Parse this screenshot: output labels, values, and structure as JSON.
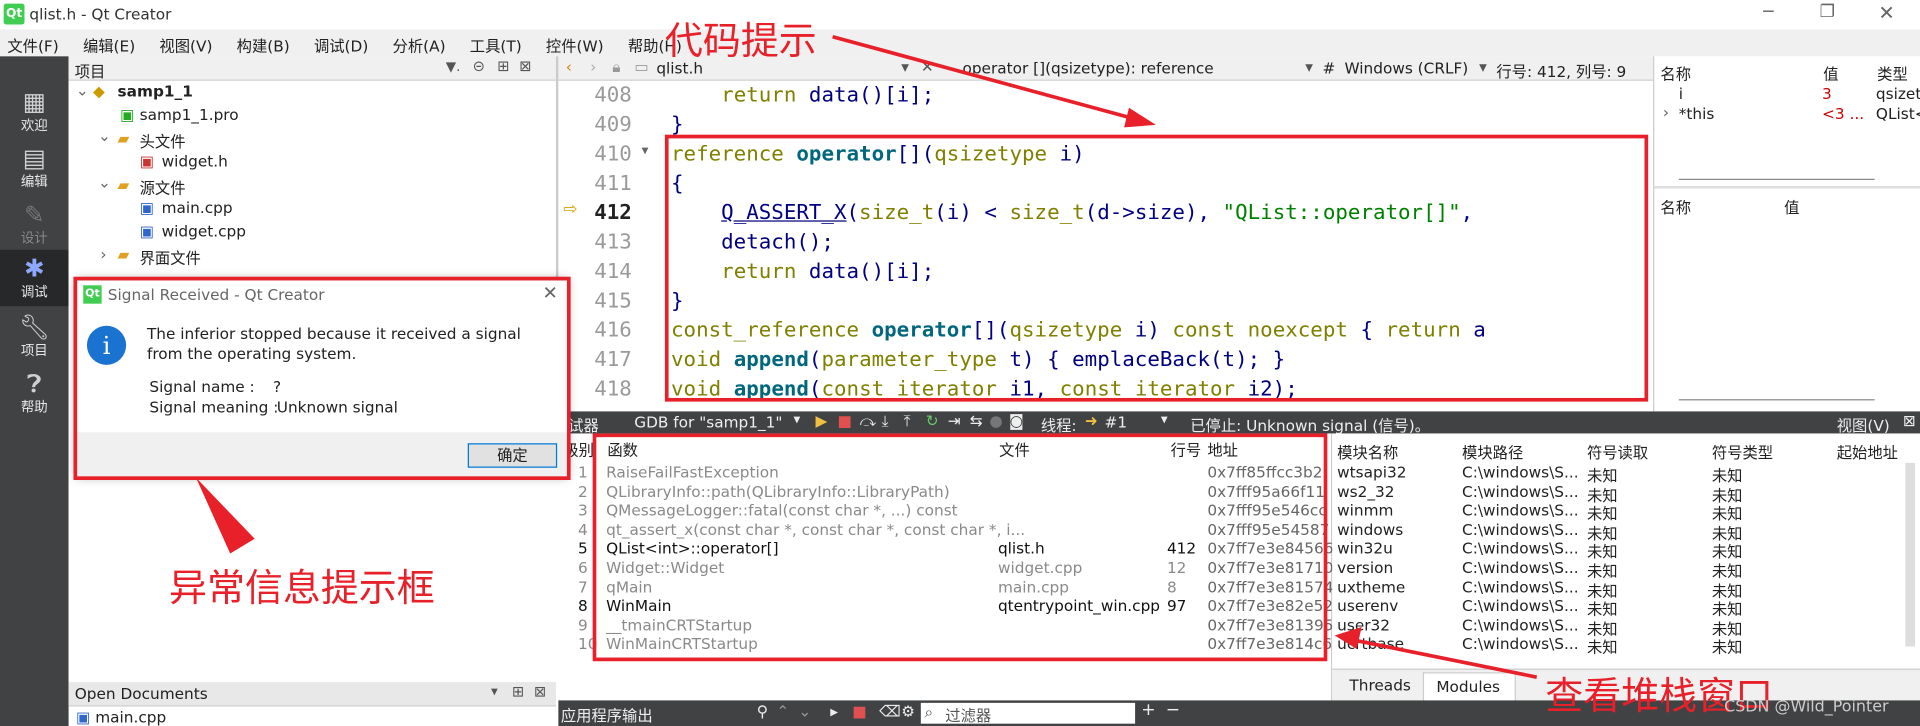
{
  "window": {
    "title": "qlist.h - Qt Creator"
  },
  "menu": [
    "文件(F)",
    "编辑(E)",
    "视图(V)",
    "构建(B)",
    "调试(D)",
    "分析(A)",
    "工具(T)",
    "控件(W)",
    "帮助(H)"
  ],
  "modes": [
    {
      "label": "欢迎",
      "icon": "grid-icon"
    },
    {
      "label": "编辑",
      "icon": "edit-icon"
    },
    {
      "label": "设计",
      "icon": "pencil-icon"
    },
    {
      "label": "调试",
      "icon": "bug-icon"
    },
    {
      "label": "项目",
      "icon": "wrench-icon"
    },
    {
      "label": "帮助",
      "icon": "help-icon"
    }
  ],
  "project": {
    "header": "项目",
    "tree": [
      {
        "label": "samp1_1",
        "bold": true,
        "icon": "project-icon"
      },
      {
        "label": "samp1_1.pro",
        "icon": "pro-file-icon"
      },
      {
        "label": "头文件",
        "icon": "folder-icon"
      },
      {
        "label": "widget.h",
        "icon": "h-file-icon"
      },
      {
        "label": "源文件",
        "icon": "folder-icon"
      },
      {
        "label": "main.cpp",
        "icon": "cpp-file-icon"
      },
      {
        "label": "widget.cpp",
        "icon": "cpp-file-icon"
      },
      {
        "label": "界面文件",
        "icon": "folder-icon"
      }
    ],
    "open_docs_header": "Open Documents",
    "open_docs": [
      "main.cpp"
    ]
  },
  "editor": {
    "file_tab": "qlist.h",
    "symbol": "operator [](qsizetype): reference",
    "hash": "#",
    "line_ending": "Windows (CRLF)",
    "position": "行号: 412, 列号: 9"
  },
  "locals": {
    "col_name": "名称",
    "col_value": "值",
    "col_type": "类型",
    "rows": [
      {
        "name": "i",
        "value": "3",
        "type": "qsizety"
      },
      {
        "name": "*this",
        "value": "<3 ...",
        "type": "QList<"
      }
    ]
  },
  "watch": {
    "col_name": "名称",
    "col_value": "值"
  },
  "debugbar": {
    "label": "试器",
    "engine": "GDB for \"samp1_1\"",
    "thread_label": "线程:",
    "thread": "#1",
    "status": "已停止: Unknown signal (信号)。",
    "view": "视图(V)"
  },
  "stack": {
    "columns": [
      "级别",
      "函数",
      "文件",
      "行号",
      "地址"
    ],
    "rows": [
      {
        "level": "1",
        "func": "RaiseFailFastException",
        "file": "",
        "line": "",
        "addr": "0x7ff85ffcc3b2",
        "active": false
      },
      {
        "level": "2",
        "func": "QLibraryInfo::path(QLibraryInfo::LibraryPath)",
        "file": "",
        "line": "",
        "addr": "0x7fff95a66f11",
        "active": false
      },
      {
        "level": "3",
        "func": "QMessageLogger::fatal(const char *, ...) const",
        "file": "",
        "line": "",
        "addr": "0x7fff95e546cc",
        "active": false
      },
      {
        "level": "4",
        "func": "qt_assert_x(const char *, const char *, const char *, i...",
        "file": "",
        "line": "",
        "addr": "0x7fff95e54587",
        "active": false
      },
      {
        "level": "5",
        "func": "QList<int>::operator[]",
        "file": "qlist.h",
        "line": "412",
        "addr": "0x7ff7e3e84566",
        "active": true
      },
      {
        "level": "6",
        "func": "Widget::Widget",
        "file": "widget.cpp",
        "line": "12",
        "addr": "0x7ff7e3e81710",
        "active": false
      },
      {
        "level": "7",
        "func": "qMain",
        "file": "main.cpp",
        "line": "8",
        "addr": "0x7ff7e3e81574",
        "active": false
      },
      {
        "level": "8",
        "func": "WinMain",
        "file": "qtentrypoint_win.cpp",
        "line": "97",
        "addr": "0x7ff7e3e82e52",
        "active": true
      },
      {
        "level": "9",
        "func": "__tmainCRTStartup",
        "file": "",
        "line": "",
        "addr": "0x7ff7e3e81395",
        "active": false
      },
      {
        "level": "10",
        "func": "WinMainCRTStartup",
        "file": "",
        "line": "",
        "addr": "0x7ff7e3e814c6",
        "active": false
      }
    ]
  },
  "modules": {
    "columns": [
      "模块名称",
      "模块路径",
      "符号读取",
      "符号类型",
      "起始地址"
    ],
    "rows": [
      {
        "name": "wtsapi32",
        "path": "C:\\windows\\S...",
        "read": "未知",
        "type": "未知"
      },
      {
        "name": "ws2_32",
        "path": "C:\\windows\\S...",
        "read": "未知",
        "type": "未知"
      },
      {
        "name": "winmm",
        "path": "C:\\windows\\S...",
        "read": "未知",
        "type": "未知"
      },
      {
        "name": "windows",
        "path": "C:\\windows\\S...",
        "read": "未知",
        "type": "未知"
      },
      {
        "name": "win32u",
        "path": "C:\\windows\\S...",
        "read": "未知",
        "type": "未知"
      },
      {
        "name": "version",
        "path": "C:\\windows\\S...",
        "read": "未知",
        "type": "未知"
      },
      {
        "name": "uxtheme",
        "path": "C:\\windows\\S...",
        "read": "未知",
        "type": "未知"
      },
      {
        "name": "userenv",
        "path": "C:\\windows\\S...",
        "read": "未知",
        "type": "未知"
      },
      {
        "name": "user32",
        "path": "C:\\windows\\S...",
        "read": "未知",
        "type": "未知"
      },
      {
        "name": "ucrtbase",
        "path": "C:\\windows\\S...",
        "read": "未知",
        "type": "未知"
      }
    ],
    "tabs": [
      "Threads",
      "Modules"
    ]
  },
  "output": {
    "label": "应用程序输出",
    "filter_placeholder": "过滤器"
  },
  "dialog": {
    "title": "Signal Received - Qt Creator",
    "message": "The inferior stopped because it received a signal from the operating system.",
    "signal_name_label": "Signal name :",
    "signal_name": "?",
    "signal_meaning_label": "Signal meaning :",
    "signal_meaning": "Unknown signal",
    "ok": "确定"
  },
  "annotations": {
    "code_hint": "代码提示",
    "exception_box": "异常信息提示框",
    "stack_window": "查看堆栈窗口",
    "watermark": "CSDN @Wild_Pointer"
  },
  "colors": {
    "annotation": "#e8202a",
    "sidebar": "#404244",
    "keyword": "#808000",
    "string": "#008000"
  }
}
